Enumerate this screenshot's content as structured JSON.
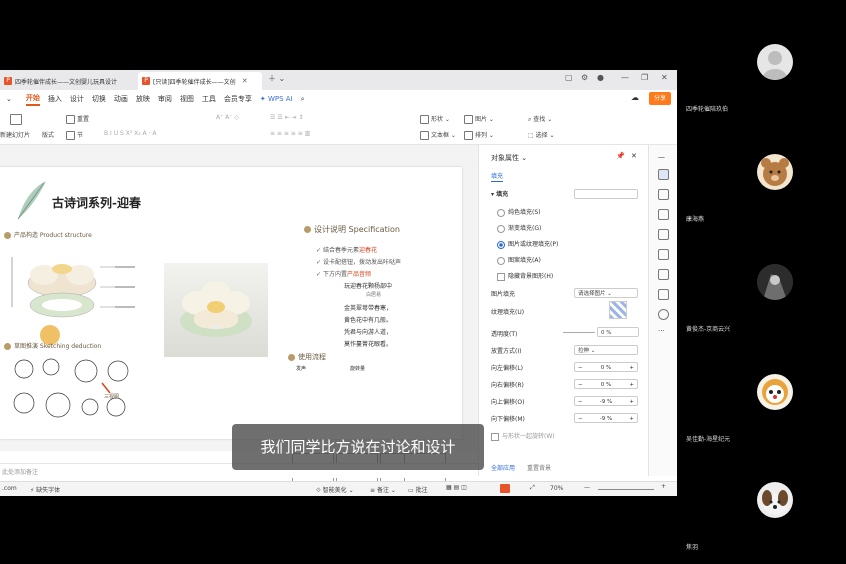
{
  "tabs": [
    {
      "label": "四季轮催伴成长——文创婴儿玩具设计",
      "active": false
    },
    {
      "label": "[只读]四季轮催伴成长——文创",
      "active": true
    }
  ],
  "menu": [
    "开始",
    "插入",
    "设计",
    "切换",
    "动画",
    "放映",
    "审阅",
    "视图",
    "工具",
    "会员专享"
  ],
  "wps_ai": "WPS AI",
  "share": "分享",
  "toolbar": {
    "new_slide": "新建幻灯片",
    "layout": "版式",
    "reset": "重置",
    "section": "节",
    "shape": "形状",
    "picture": "图片",
    "find": "查找",
    "textbox": "文本框",
    "arrange": "排列",
    "select": "选择"
  },
  "slide": {
    "title": "古诗词系列-迎春",
    "structure": "产品构造 Product structure",
    "sketch": "草图推演 Sketching deduction",
    "spec": "设计说明 Specification",
    "bullets": [
      [
        "结合春季元素",
        "迎春花"
      ],
      [
        "设卡配搭钮，拨动发出咔哒声",
        ""
      ],
      [
        "下方内置",
        "产品音频"
      ]
    ],
    "poem": [
      "玩迎春花颗杨部中",
      "白居易",
      "金英翠萼带春寒，",
      "黄色花中有几般。",
      "凭君与向游人道，",
      "莫作蔓菁花眼看。"
    ],
    "usage": "使用流程",
    "usage_steps": [
      "发声",
      "旋转量"
    ],
    "three_view": "三视图"
  },
  "notes_placeholder": "此处添加备注",
  "panel": {
    "title": "对象属性",
    "tab": "填充",
    "fill_label": "填充",
    "options": [
      {
        "label": "纯色填充(S)",
        "on": false
      },
      {
        "label": "渐变填充(G)",
        "on": false
      },
      {
        "label": "图片或纹理填充(P)",
        "on": true
      },
      {
        "label": "图案填充(A)",
        "on": false
      }
    ],
    "hide_bg": "隐藏背景图形(H)",
    "pic_fill": "图片填充",
    "pic_fill_value": "请选择图片",
    "texture": "纹理填充(U)",
    "transparency": "透明度(T)",
    "transparency_value": "0 %",
    "placement": "放置方式(I)",
    "placement_value": "拉伸",
    "offsets": [
      {
        "label": "向左偏移(L)",
        "value": "0 %"
      },
      {
        "label": "向右偏移(R)",
        "value": "0 %"
      },
      {
        "label": "向上偏移(O)",
        "value": "-9 %"
      },
      {
        "label": "向下偏移(M)",
        "value": "-9 %"
      }
    ],
    "rotate_with": "与形状一起旋转(W)",
    "apply_all": "全部应用",
    "reset_bg": "重置背景"
  },
  "status": {
    "url": ".com",
    "missing_font": "缺失字体",
    "beautify": "智能美化",
    "notes": "备注",
    "comments": "批注",
    "zoom": "70%"
  },
  "subtitle": "我们同学比方说在讨论和设计",
  "participants": [
    {
      "name": "四季轮催陪玖伯"
    },
    {
      "name": "康海燕"
    },
    {
      "name": "黄俊杰-京商云兴"
    },
    {
      "name": "吴佳勤-海星纪元"
    },
    {
      "name": "焦羽"
    }
  ],
  "colors": {
    "accent": "#e05a1a",
    "share": "#ff7a1a",
    "highlight": "#d6461e",
    "radio": "#2b6bd6"
  }
}
